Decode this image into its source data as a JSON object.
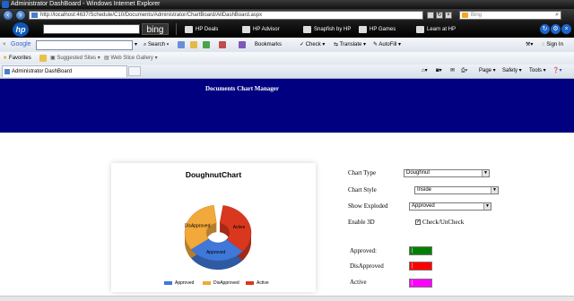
{
  "window": {
    "title": "Administrator DashBoard - Windows Internet Explorer"
  },
  "address_bar": {
    "url": "http://localhost:4637/Schedule/C10/Documents/Administrator/ChartBoard/AllDashBoard.aspx",
    "search_placeholder": "Bing"
  },
  "hp_toolbar": {
    "logo": "hp",
    "search_brand": "bing",
    "links": [
      "HP Deals",
      "HP Advisor",
      "Snapfish by HP",
      "HP Games",
      "Learn at HP"
    ]
  },
  "google_toolbar": {
    "brand": "Google",
    "search_label": "Search",
    "items": [
      "Bookmarks",
      "Check",
      "Translate",
      "AutoFill"
    ],
    "sign_in": "Sign In"
  },
  "favorites_bar": {
    "favorites": "Favorites",
    "items": [
      "Suggested Sites",
      "Web Slice Gallery"
    ]
  },
  "tab": {
    "title": "Administrator DashBoard"
  },
  "command_bar": {
    "items": [
      "Page",
      "Safety",
      "Tools"
    ]
  },
  "page": {
    "banner_title": "Documents Chart Manager",
    "chart": {
      "title": "DoughnutChart"
    },
    "settings": {
      "chart_type_label": "Chart Type",
      "chart_type_value": "Doughnut",
      "chart_style_label": "Chart Style",
      "chart_style_value": "Inside",
      "show_exploded_label": "Show Exploded",
      "show_exploded_value": "Approved",
      "enable3d_label": "Enable 3D",
      "enable3d_checkbox_label": "Check/UnCheck",
      "enable3d_checked": true
    },
    "colors": [
      {
        "label": "Approved:",
        "hex": "#008000"
      },
      {
        "label": "DisApproved",
        "hex": "#ff0000"
      },
      {
        "label": "Active",
        "hex": "#ff00ff"
      }
    ]
  },
  "chart_data": {
    "type": "pie",
    "title": "DoughnutChart",
    "categories": [
      "Approved",
      "DisApproved",
      "Active"
    ],
    "values": [
      33,
      33,
      34
    ],
    "colors": [
      "#3f78d8",
      "#f2a83a",
      "#d9381e"
    ],
    "legend_position": "bottom",
    "doughnut": true,
    "three_d": true
  }
}
